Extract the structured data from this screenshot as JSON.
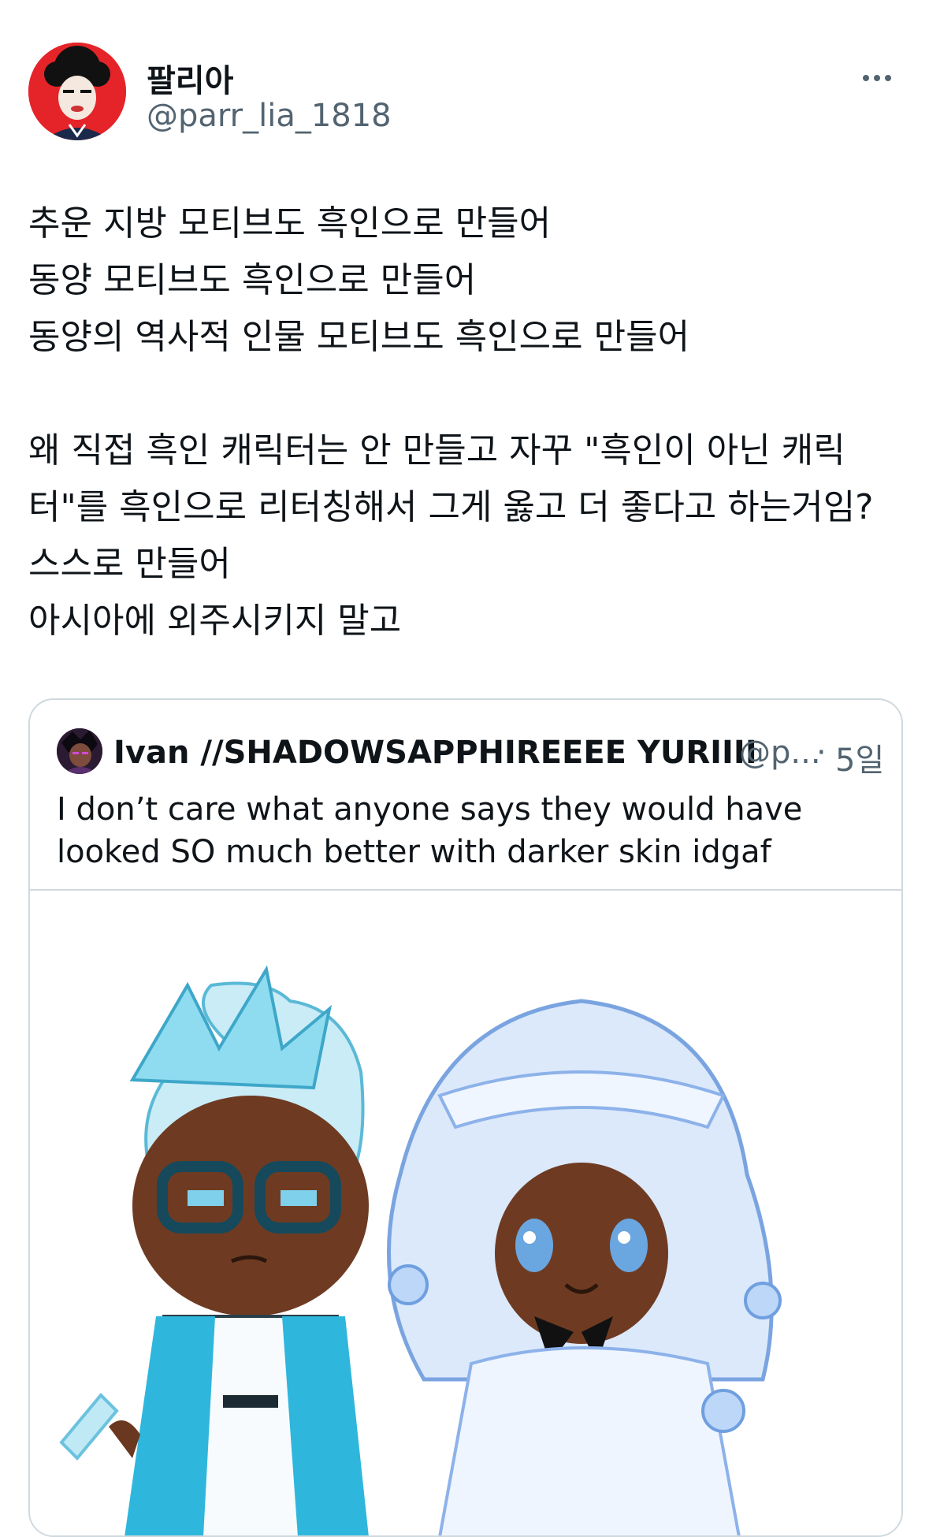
{
  "author": {
    "display_name": "팔리아",
    "handle": "@parr_lia_1818"
  },
  "tweet": {
    "lines": [
      "추운 지방 모티브도 흑인으로 만들어",
      "동양 모티브도 흑인으로 만들어",
      "동양의 역사적 인물 모티브도 흑인으로 만들어",
      "",
      "왜 직접 흑인 캐릭터는 안 만들고 자꾸 \"흑인이 아닌 캐릭",
      "터\"를 흑인으로 리터칭해서 그게 옳고 더 좋다고 하는거임?",
      "스스로 만들어",
      "아시아에 외주시키지 말고"
    ]
  },
  "quote": {
    "name": "Ivan //SHADOWSAPPHIREEEE YURIIII",
    "handle": "@p...",
    "separator": "·",
    "time": "5일",
    "text_lines": [
      "I don’t care what anyone says they would have",
      "looked SO much better with darker skin idgaf"
    ]
  },
  "icons": {
    "more": "more-horizontal-icon"
  },
  "colors": {
    "text_primary": "#0f1419",
    "text_secondary": "#536471",
    "border": "#cfd9de",
    "avatar_bg": "#e5242a"
  }
}
